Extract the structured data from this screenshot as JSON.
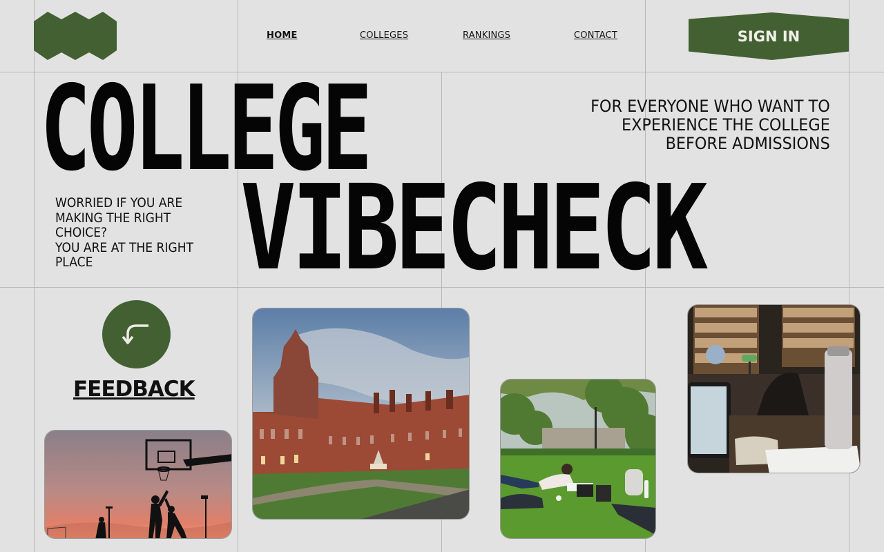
{
  "brand": {
    "logo_icon": "hexagon-logo-icon",
    "color": "#436033"
  },
  "nav": {
    "items": [
      {
        "label": "HOME",
        "active": true
      },
      {
        "label": "COLLEGES",
        "active": false
      },
      {
        "label": "RANKINGS",
        "active": false
      },
      {
        "label": "CONTACT",
        "active": false
      }
    ]
  },
  "header": {
    "signin_label": "SIGN IN"
  },
  "hero": {
    "title_line1": "COLLEGE",
    "title_line2": "VIBECHECK",
    "tagline_lines": [
      "FOR EVERYONE WHO WANT TO",
      "EXPERIENCE THE COLLEGE",
      "BEFORE ADMISSIONS"
    ],
    "intro_lines": [
      "WORRIED IF YOU ARE",
      "MAKING THE RIGHT",
      "CHOICE?",
      "YOU ARE AT THE RIGHT",
      "PLACE"
    ]
  },
  "feedback": {
    "label": "FEEDBACK",
    "icon": "curved-arrow-icon"
  },
  "photos": [
    {
      "subject": "basketball-sunset-photo"
    },
    {
      "subject": "college-building-photo"
    },
    {
      "subject": "lawn-study-photo"
    },
    {
      "subject": "library-photo"
    }
  ],
  "colors": {
    "background": "#e2e2e2",
    "accent": "#436033",
    "grid": "#b8b8b8",
    "text": "#0c0c0c"
  }
}
